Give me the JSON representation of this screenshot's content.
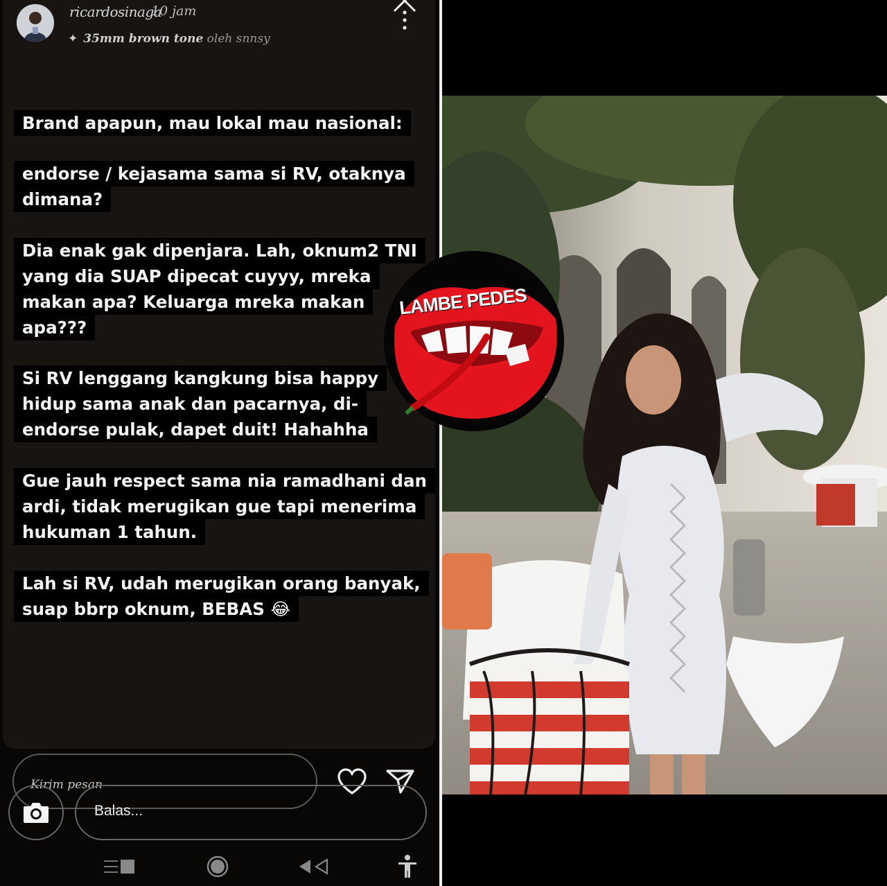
{
  "story": {
    "username": "ricardosinaga",
    "time": "10 jam",
    "filter_name": "35mm brown tone",
    "filter_by": "oleh snnsy",
    "paragraphs": [
      [
        "Brand apapun, mau lokal mau nasional:"
      ],
      [
        "endorse / kejasama sama si RV, otaknya",
        "dimana?"
      ],
      [
        "Dia enak gak dipenjara. Lah, oknum2 TNI",
        "yang dia SUAP dipecat cuyyy, mreka",
        "makan apa? Keluarga mreka makan",
        "apa???"
      ],
      [
        "Si RV lenggang kangkung bisa happy",
        "hidup sama anak dan pacarnya, di-",
        "endorse pulak, dapet duit! Hahahha"
      ],
      [
        "Gue jauh respect sama nia ramadhani dan",
        "ardi, tidak merugikan gue tapi menerima",
        "hukuman 1 tahun."
      ],
      [
        "Lah si RV, udah merugikan orang banyak,",
        "suap bbrp oknum, BEBAS 😂"
      ]
    ],
    "message_placeholder": "Kirim pesan",
    "reply_placeholder": "Balas..."
  },
  "logo": {
    "text": "LAMBE PEDES"
  },
  "colors": {
    "lips": "#e3141e",
    "story_bg": "#171412",
    "text_bg": "#000000"
  }
}
